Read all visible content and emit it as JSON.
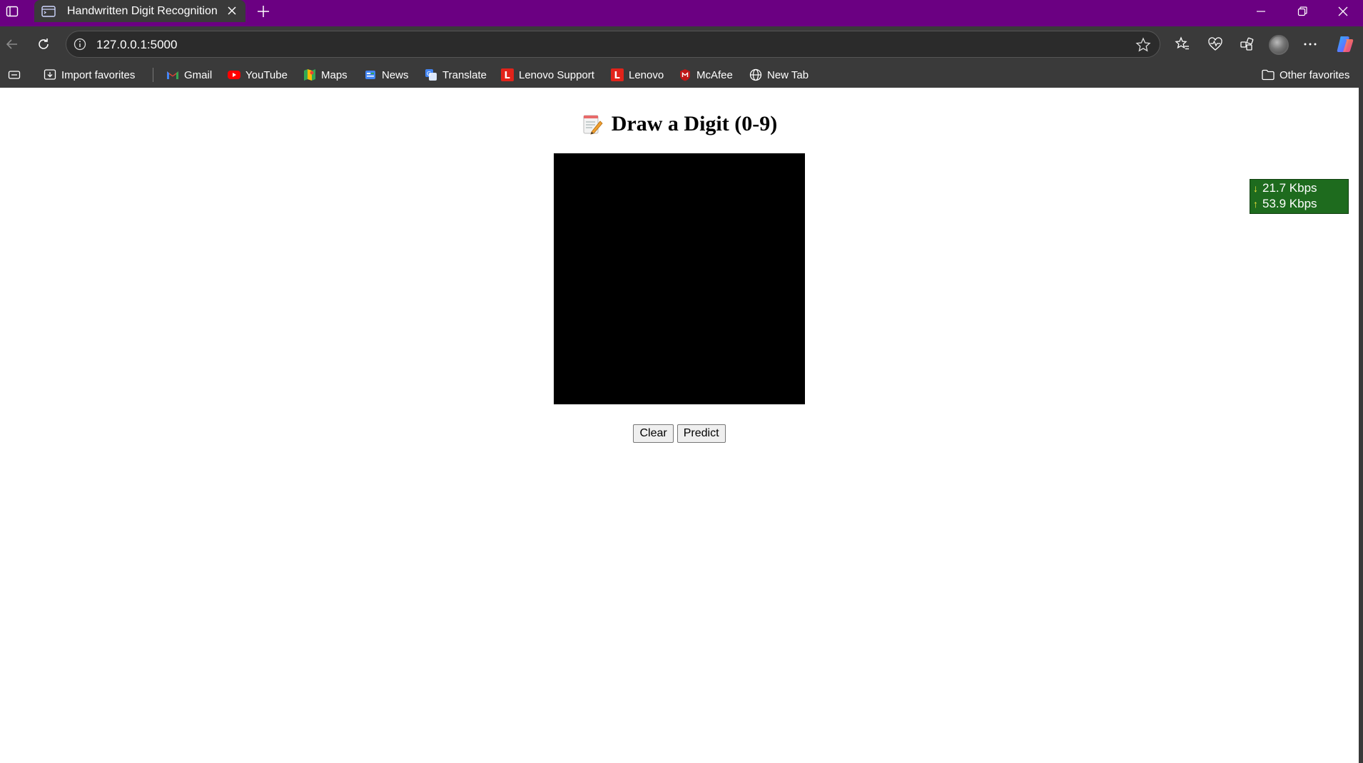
{
  "browser": {
    "tab": {
      "title": "Handwritten Digit Recognition"
    },
    "address_bar": {
      "url": "127.0.0.1:5000"
    },
    "favorites": [
      {
        "label": "Import favorites",
        "icon": "import-favorites-icon"
      },
      {
        "label": "Gmail",
        "icon": "gmail-icon"
      },
      {
        "label": "YouTube",
        "icon": "youtube-icon"
      },
      {
        "label": "Maps",
        "icon": "maps-icon"
      },
      {
        "label": "News",
        "icon": "news-icon"
      },
      {
        "label": "Translate",
        "icon": "translate-icon"
      },
      {
        "label": "Lenovo Support",
        "icon": "lenovo-icon"
      },
      {
        "label": "Lenovo",
        "icon": "lenovo-icon"
      },
      {
        "label": "McAfee",
        "icon": "mcafee-icon"
      },
      {
        "label": "New Tab",
        "icon": "globe-icon"
      }
    ],
    "other_favorites": {
      "label": "Other favorites",
      "icon": "folder-icon"
    }
  },
  "page": {
    "heading": "Draw a Digit (0-9)",
    "heading_icon": "memo-icon",
    "canvas_color": "#000000",
    "buttons": {
      "clear": "Clear",
      "predict": "Predict"
    }
  },
  "network_monitor": {
    "download": "21.7 Kbps",
    "upload": "53.9 Kbps",
    "background": "#1e6b1e"
  },
  "colors": {
    "titlebar": "#6b0082",
    "toolbar": "#3a3a3a"
  }
}
